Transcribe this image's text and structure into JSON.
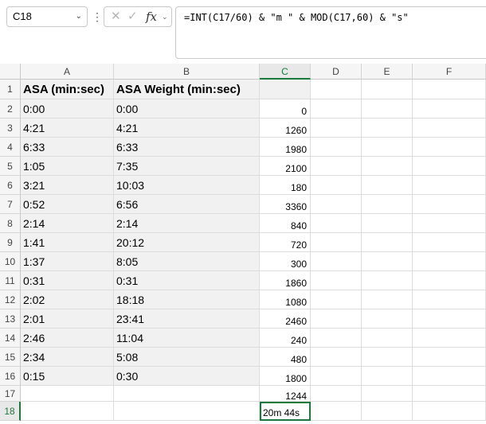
{
  "formula_bar": {
    "name_box": "C18",
    "formula": "=INT(C17/60) & \"m \" & MOD(C17,60) & \"s\""
  },
  "columns": [
    "A",
    "B",
    "C",
    "D",
    "E",
    "F"
  ],
  "header_row": {
    "a": "ASA (min:sec)",
    "b": "ASA Weight (min:sec)",
    "c": ""
  },
  "rows": [
    {
      "num": "1"
    },
    {
      "num": "2",
      "a": "0:00",
      "b": "0:00",
      "c": "0"
    },
    {
      "num": "3",
      "a": "4:21",
      "b": "4:21",
      "c": "1260"
    },
    {
      "num": "4",
      "a": "6:33",
      "b": "6:33",
      "c": "1980"
    },
    {
      "num": "5",
      "a": "1:05",
      "b": "7:35",
      "c": "2100"
    },
    {
      "num": "6",
      "a": "3:21",
      "b": "10:03",
      "c": "180"
    },
    {
      "num": "7",
      "a": "0:52",
      "b": "6:56",
      "c": "3360"
    },
    {
      "num": "8",
      "a": "2:14",
      "b": "2:14",
      "c": "840"
    },
    {
      "num": "9",
      "a": "1:41",
      "b": "20:12",
      "c": "720"
    },
    {
      "num": "10",
      "a": "1:37",
      "b": "8:05",
      "c": "300"
    },
    {
      "num": "11",
      "a": "0:31",
      "b": "0:31",
      "c": "1860"
    },
    {
      "num": "12",
      "a": "2:02",
      "b": "18:18",
      "c": "1080"
    },
    {
      "num": "13",
      "a": "2:01",
      "b": "23:41",
      "c": "2460"
    },
    {
      "num": "14",
      "a": "2:46",
      "b": "11:04",
      "c": "240"
    },
    {
      "num": "15",
      "a": "2:34",
      "b": "5:08",
      "c": "480"
    },
    {
      "num": "16",
      "a": "0:15",
      "b": "0:30",
      "c": "1800"
    },
    {
      "num": "17",
      "a": "",
      "b": "",
      "c": "1244"
    },
    {
      "num": "18",
      "a": "",
      "b": "",
      "c": "20m 44s"
    }
  ],
  "colors": {
    "accent": "#1a7a3e",
    "shade": "#f1f1f1"
  }
}
